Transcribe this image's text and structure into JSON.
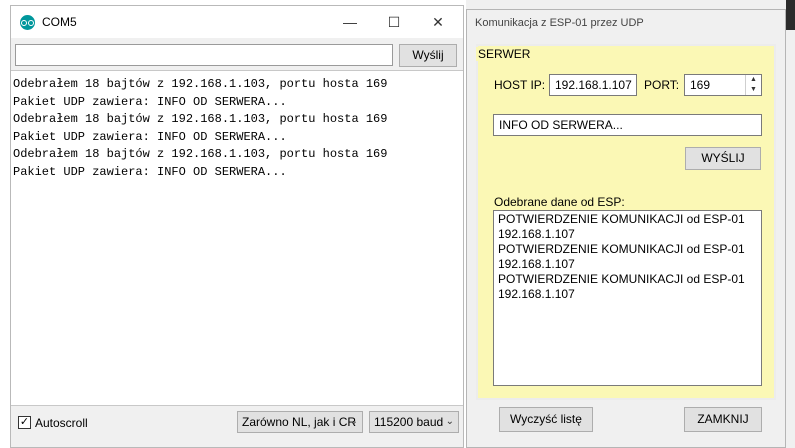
{
  "com_window": {
    "title": "COM5",
    "send_input": {
      "value": "",
      "placeholder": ""
    },
    "send_button": "Wyślij",
    "console_lines": [
      "Odebrałem 18 bajtów z 192.168.1.103, portu hosta 169",
      "Pakiet UDP zawiera: INFO OD SERWERA...",
      "Odebrałem 18 bajtów z 192.168.1.103, portu hosta 169",
      "Pakiet UDP zawiera: INFO OD SERWERA...",
      "Odebrałem 18 bajtów z 192.168.1.103, portu hosta 169",
      "Pakiet UDP zawiera: INFO OD SERWERA..."
    ],
    "autoscroll": {
      "label": "Autoscroll",
      "checked": true
    },
    "line_ending_select": "Zarówno NL, jak i CR",
    "baud_select": "115200 baud",
    "icons": [
      "arduino-icon",
      "minimize-icon",
      "maximize-icon",
      "close-icon",
      "chevron-down-icon"
    ]
  },
  "dialog": {
    "title": "Komunikacja z ESP-01 przez UDP",
    "group_label": "SERWER",
    "host_ip_label": "HOST IP:",
    "host_ip_value": "192.168.1.107",
    "port_label": "PORT:",
    "port_value": "169",
    "message_value": "INFO OD SERWERA...",
    "send_button": "WYŚLIJ",
    "received_label": "Odebrane dane od ESP:",
    "received_lines": [
      "POTWIERDZENIE KOMUNIKACJI od ESP-01",
      "192.168.1.107",
      "POTWIERDZENIE KOMUNIKACJI od ESP-01",
      "192.168.1.107",
      "POTWIERDZENIE KOMUNIKACJI od ESP-01",
      "192.168.1.107"
    ],
    "clear_button": "Wyczyść listę",
    "close_button": "ZAMKNIJ",
    "colors": {
      "panel_background": "#fbf8b5"
    }
  }
}
